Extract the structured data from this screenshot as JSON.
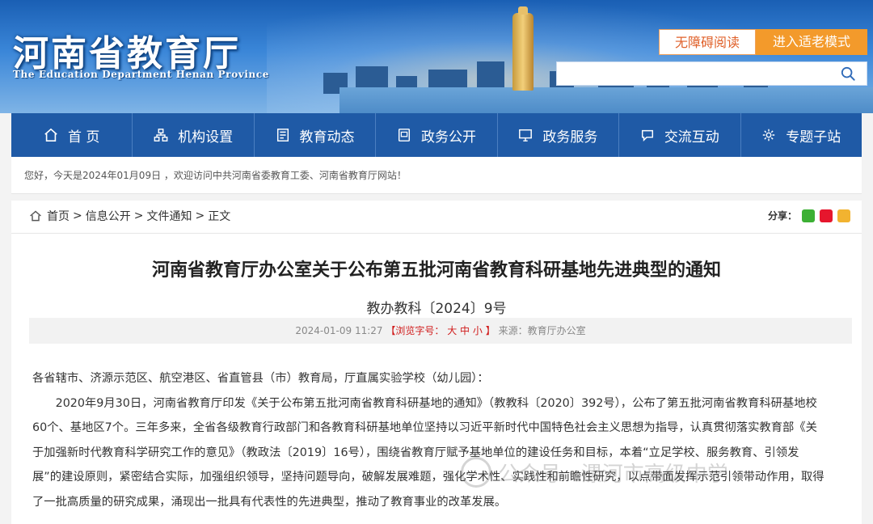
{
  "header": {
    "title": "河南省教育厅",
    "subtitle": "The Education Department Henan Province",
    "accessibility_label": "无障碍阅读",
    "elder_mode_label": "进入适老模式",
    "search_placeholder": ""
  },
  "nav": {
    "items": [
      {
        "label": "首 页",
        "icon": "home-icon"
      },
      {
        "label": "机构设置",
        "icon": "org-icon"
      },
      {
        "label": "教育动态",
        "icon": "news-icon"
      },
      {
        "label": "政务公开",
        "icon": "document-icon"
      },
      {
        "label": "政务服务",
        "icon": "monitor-icon"
      },
      {
        "label": "交流互动",
        "icon": "chat-icon"
      },
      {
        "label": "专题子站",
        "icon": "gear-icon"
      }
    ]
  },
  "welcome": "您好，今天是2024年01月09日 ，欢迎访问中共河南省委教育工委、河南省教育厅网站！",
  "breadcrumb": {
    "items": [
      "首页",
      "信息公开",
      "文件通知",
      "正文"
    ],
    "separator": ">"
  },
  "share_label": "分享：",
  "article": {
    "title": "河南省教育厅办公室关于公布第五批河南省教育科研基地先进典型的通知",
    "doc_number": "教办教科〔2024〕9号",
    "date": "2024-01-09 11:27",
    "font_size_prefix": "【浏览字号：",
    "font_sizes": [
      "大",
      "中",
      "小"
    ],
    "font_size_suffix": "】",
    "source": "来源：教育厅办公室",
    "recipients": "各省辖市、济源示范区、航空港区、省直管县（市）教育局，厅直属实验学校（幼儿园）：",
    "paragraph": "2020年9月30日，河南省教育厅印发《关于公布第五批河南省教育科研基地的通知》（教教科〔2020〕392号），公布了第五批河南省教育科研基地校60个、基地区7个。三年多来，全省各级教育行政部门和各教育科研基地单位坚持以习近平新时代中国特色社会主义思想为指导，认真贯彻落实教育部《关于加强新时代教育科学研究工作的意见》（教政法〔2019〕16号），围绕省教育厅赋予基地单位的建设任务和目标，本着“立足学校、服务教育、引领发展”的建设原则，紧密结合实际，加强组织领导，坚持问题导向，破解发展难题，强化学术性、实践性和前瞻性研究，以点带面发挥示范引领带动作用，取得了一批高质量的研究成果，涌现出一批具有代表性的先进典型，推动了教育事业的改革发展。"
  },
  "watermark": "公众号 · 漯河市高级中学",
  "colors": {
    "nav_bg": "#1f5aa6",
    "accent_orange": "#f39a2b",
    "alert_red": "#d01c1c"
  }
}
